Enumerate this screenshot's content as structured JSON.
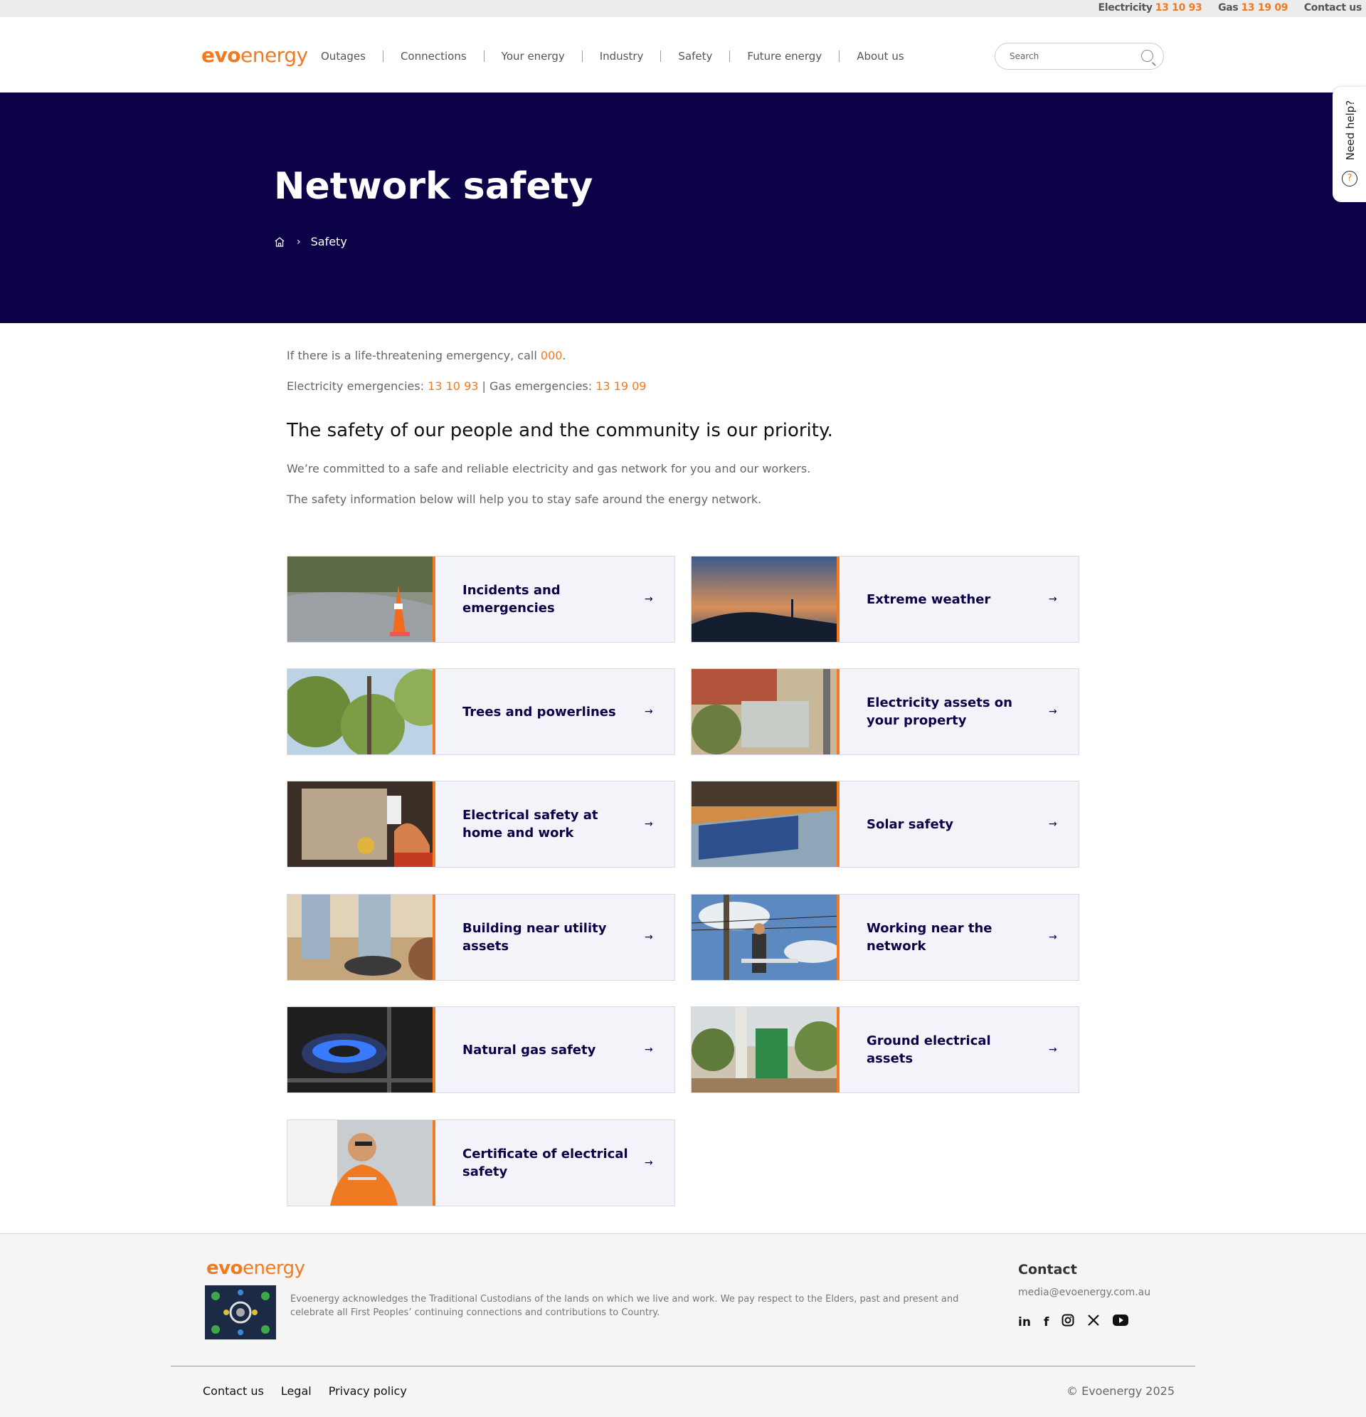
{
  "topbar": {
    "electricity_label": "Electricity",
    "electricity_number": "13 10 93",
    "gas_label": "Gas",
    "gas_number": "13 19 09",
    "contact_label": "Contact us"
  },
  "brand": {
    "logo_evo": "evo",
    "logo_energy": "energy",
    "accent": "#f07a21",
    "navy": "#0c0248"
  },
  "nav": {
    "items": [
      "Outages",
      "Connections",
      "Your energy",
      "Industry",
      "Safety",
      "Future energy",
      "About us"
    ]
  },
  "search": {
    "placeholder": "Search"
  },
  "hero": {
    "title": "Network safety",
    "breadcrumb_current": "Safety"
  },
  "help_tab": {
    "label": "Need help?",
    "icon": "question-icon"
  },
  "emergency": {
    "line1_prefix": "If there is a life-threatening emergency, call ",
    "line1_number": "000",
    "line1_suffix": ".",
    "elec_label": "Electricity emergencies: ",
    "elec_number": "13 10 93",
    "gas_label": " | Gas emergencies: ",
    "gas_number": "13 19 09"
  },
  "intro": {
    "heading": "The safety of our people and the community is our priority.",
    "p1": "We’re committed to a safe and reliable electricity and gas network for you and our workers.",
    "p2": "The safety information below will help you to stay safe around the energy network."
  },
  "cards": [
    {
      "label": "Incidents and emergencies"
    },
    {
      "label": "Extreme weather"
    },
    {
      "label": "Trees and powerlines"
    },
    {
      "label": "Electricity assets on your property"
    },
    {
      "label": "Electrical safety at home and work"
    },
    {
      "label": "Solar safety"
    },
    {
      "label": "Building near utility assets"
    },
    {
      "label": "Working near the network"
    },
    {
      "label": "Natural gas safety"
    },
    {
      "label": "Ground electrical assets"
    },
    {
      "label": "Certificate of electrical safety"
    }
  ],
  "card_arrow": "→",
  "footer": {
    "acknowledgement": "Evoenergy acknowledges the Traditional Custodians of the lands on which we live and work. We pay respect to the Elders, past and present and celebrate all First Peoples’ continuing connections and contributions to Country.",
    "contact_heading": "Contact",
    "contact_email": "media@evoenergy.com.au",
    "social": [
      "linkedin-icon",
      "facebook-icon",
      "instagram-icon",
      "x-icon",
      "youtube-icon"
    ],
    "links": [
      "Contact us",
      "Legal",
      "Privacy policy"
    ],
    "copyright": "© Evoenergy 2025"
  }
}
